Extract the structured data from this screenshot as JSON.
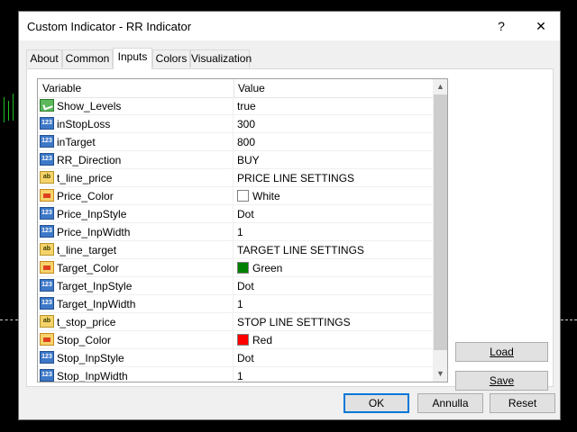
{
  "window": {
    "title": "Custom Indicator - RR Indicator",
    "help_glyph": "?",
    "close_glyph": "✕"
  },
  "tabs": [
    {
      "label": "About"
    },
    {
      "label": "Common"
    },
    {
      "label": "Inputs"
    },
    {
      "label": "Colors"
    },
    {
      "label": "Visualization"
    }
  ],
  "grid": {
    "header": {
      "variable": "Variable",
      "value": "Value"
    },
    "rows": [
      {
        "icon": "bool-icon",
        "name": "Show_Levels",
        "value": "true"
      },
      {
        "icon": "number-icon",
        "name": "inStopLoss",
        "value": "300"
      },
      {
        "icon": "number-icon",
        "name": "inTarget",
        "value": "800"
      },
      {
        "icon": "number-icon",
        "name": "RR_Direction",
        "value": "BUY"
      },
      {
        "icon": "string-icon",
        "name": "t_line_price",
        "value": "PRICE LINE SETTINGS"
      },
      {
        "icon": "color-icon",
        "name": "Price_Color",
        "value": "White",
        "swatch": "#ffffff"
      },
      {
        "icon": "number-icon",
        "name": "Price_InpStyle",
        "value": "Dot"
      },
      {
        "icon": "number-icon",
        "name": "Price_InpWidth",
        "value": "1"
      },
      {
        "icon": "string-icon",
        "name": "t_line_target",
        "value": "TARGET LINE SETTINGS"
      },
      {
        "icon": "color-icon",
        "name": "Target_Color",
        "value": "Green",
        "swatch": "#008000"
      },
      {
        "icon": "number-icon",
        "name": "Target_InpStyle",
        "value": "Dot"
      },
      {
        "icon": "number-icon",
        "name": "Target_InpWidth",
        "value": "1"
      },
      {
        "icon": "string-icon",
        "name": "t_stop_price",
        "value": "STOP LINE SETTINGS"
      },
      {
        "icon": "color-icon",
        "name": "Stop_Color",
        "value": "Red",
        "swatch": "#ff0000"
      },
      {
        "icon": "number-icon",
        "name": "Stop_InpStyle",
        "value": "Dot"
      },
      {
        "icon": "number-icon",
        "name": "Stop_InpWidth",
        "value": "1"
      }
    ]
  },
  "side_buttons": {
    "load": "Load",
    "save": "Save"
  },
  "footer_buttons": {
    "ok": "OK",
    "cancel": "Annulla",
    "reset": "Reset"
  },
  "icon_glyphs": {
    "number": "123",
    "string": "ab"
  },
  "colors": {
    "accent": "#0078d7",
    "dialog_bg": "#f0f0f0"
  }
}
